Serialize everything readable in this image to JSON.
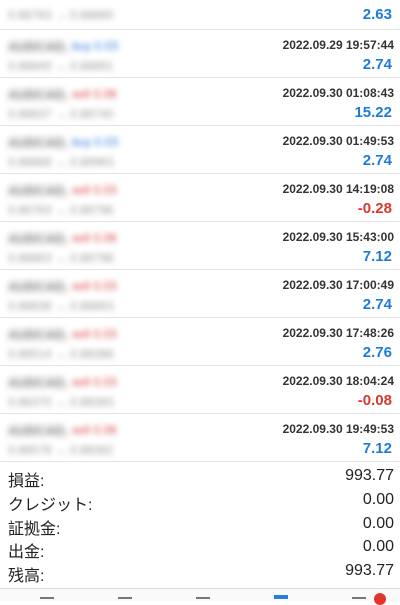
{
  "history": [
    {
      "symbol": "AUDCAD,",
      "trade": "",
      "side": "",
      "prices": "0.88783 → 0.88880",
      "time": "",
      "profit": "2.63"
    },
    {
      "symbol": "AUDCAD,",
      "trade": "buy 0.03",
      "side": "buy",
      "prices": "0.88840 → 0.88891",
      "time": "2022.09.29 19:57:44",
      "profit": "2.74"
    },
    {
      "symbol": "AUDCAD,",
      "trade": "sell 0.08",
      "side": "sell",
      "prices": "0.88837 → 0.88740",
      "time": "2022.09.30 01:08:43",
      "profit": "15.22"
    },
    {
      "symbol": "AUDCAD,",
      "trade": "buy 0.03",
      "side": "buy",
      "prices": "0.88868 → 0.88963",
      "time": "2022.09.30 01:49:53",
      "profit": "2.74"
    },
    {
      "symbol": "AUDCAD,",
      "trade": "sell 0.03",
      "side": "sell",
      "prices": "0.88783 → 0.88796",
      "time": "2022.09.30 14:19:08",
      "profit": "-0.28"
    },
    {
      "symbol": "AUDCAD,",
      "trade": "sell 0.08",
      "side": "sell",
      "prices": "0.88863 → 0.88798",
      "time": "2022.09.30 15:43:00",
      "profit": "7.12"
    },
    {
      "symbol": "AUDCAD,",
      "trade": "sell 0.03",
      "side": "sell",
      "prices": "0.88838 → 0.88863",
      "time": "2022.09.30 17:00:49",
      "profit": "2.74"
    },
    {
      "symbol": "AUDCAD,",
      "trade": "sell 0.03",
      "side": "sell",
      "prices": "0.88514 → 0.88388",
      "time": "2022.09.30 17:48:26",
      "profit": "2.76"
    },
    {
      "symbol": "AUDCAD,",
      "trade": "sell 0.03",
      "side": "sell",
      "prices": "0.88370 → 0.88383",
      "time": "2022.09.30 18:04:24",
      "profit": "-0.08"
    },
    {
      "symbol": "AUDCAD,",
      "trade": "sell 0.08",
      "side": "sell",
      "prices": "0.88578 → 0.88382",
      "time": "2022.09.30 19:49:53",
      "profit": "7.12"
    }
  ],
  "summary": {
    "profit_label": "損益:",
    "profit_value": "993.77",
    "credit_label": "クレジット:",
    "credit_value": "0.00",
    "margin_label": "証拠金:",
    "margin_value": "0.00",
    "withdrawal_label": "出金:",
    "withdrawal_value": "0.00",
    "balance_label": "残高:",
    "balance_value": "993.77"
  },
  "colors": {
    "positive": "#1e7dd3",
    "negative": "#d63a2f",
    "buy": "#2a7de1",
    "sell": "#d4453c"
  },
  "tabbar": {
    "icons": [
      "quotes-icon",
      "chart-icon",
      "trade-icon",
      "history-icon",
      "settings-icon"
    ],
    "active": "history-icon"
  }
}
